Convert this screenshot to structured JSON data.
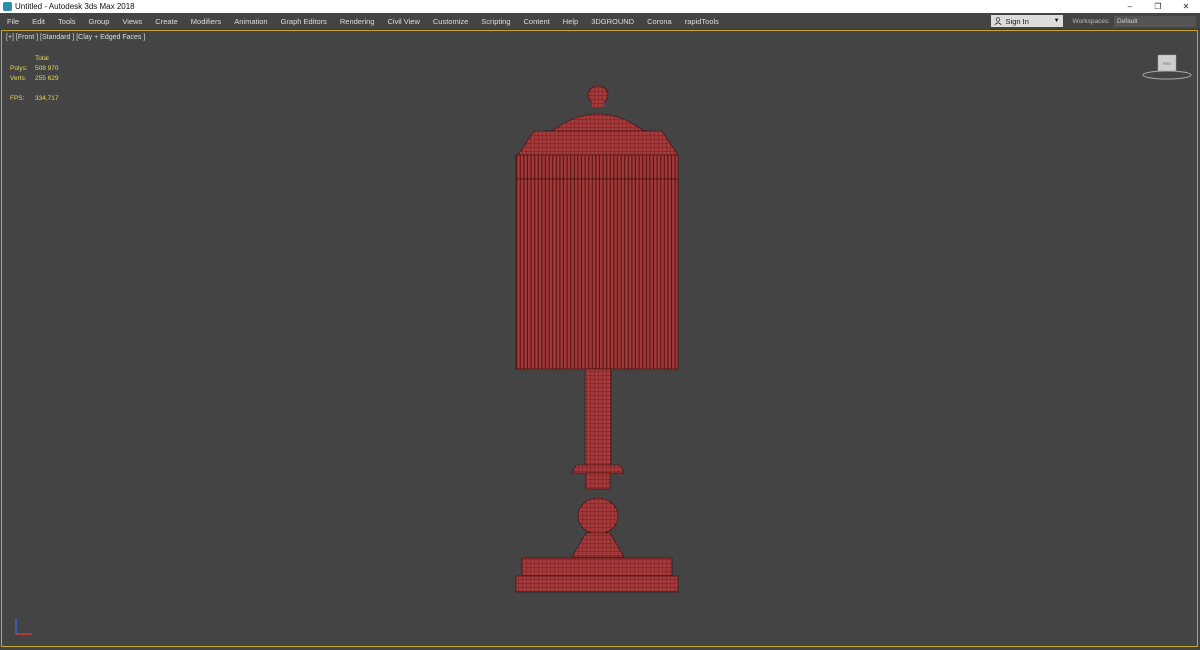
{
  "window": {
    "title": "Untitled - Autodesk 3ds Max 2018",
    "controls": [
      "–",
      "❐",
      "✕"
    ]
  },
  "menu": {
    "items": [
      "File",
      "Edit",
      "Tools",
      "Group",
      "Views",
      "Create",
      "Modifiers",
      "Animation",
      "Graph Editors",
      "Rendering",
      "Civil View",
      "Customize",
      "Scripting",
      "Content",
      "Help",
      "3DGROUND",
      "Corona",
      "rapidTools"
    ],
    "signin_label": "Sign In",
    "workspaces_label": "Workspaces:",
    "workspace_value": "Default"
  },
  "viewport": {
    "label": "[+] [Front ] [Standard ] [Clay + Edged Faces ]",
    "stats": {
      "header": "Total",
      "polys_label": "Polys:",
      "polys_value": "508 970",
      "verts_label": "Verts:",
      "verts_value": "255 629",
      "fps_label": "FPS:",
      "fps_value": "334,717"
    },
    "viewcube_label": "FRO",
    "border_color": "#c7a72a",
    "model_color": "#a8393a",
    "wire_color": "#3a0d0d",
    "icons": [
      "viewcube-icon",
      "axis-tripod-icon",
      "user-icon",
      "app-icon"
    ]
  }
}
